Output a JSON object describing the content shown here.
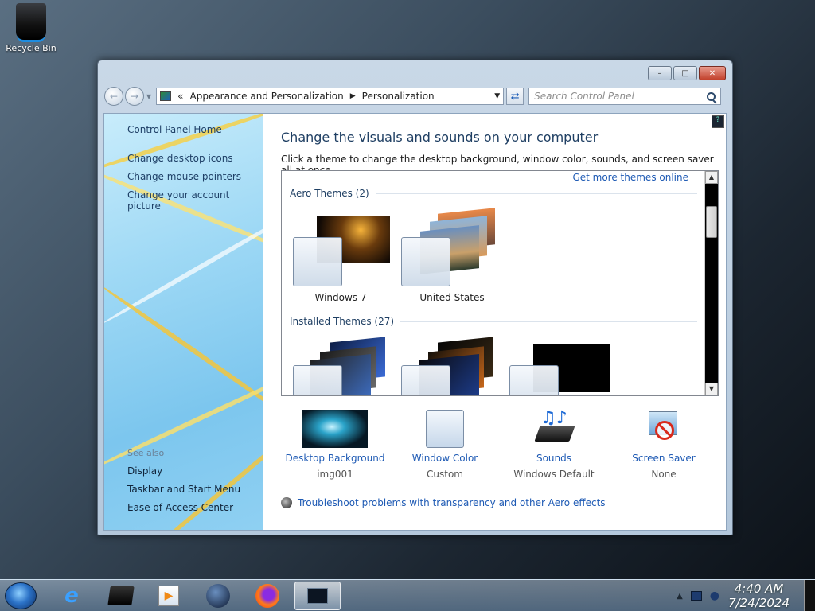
{
  "desktop": {
    "recycle_bin_label": "Recycle Bin"
  },
  "navbar": {
    "breadcrumb_root": "«",
    "crumb1": "Appearance and Personalization",
    "crumb2": "Personalization",
    "search_placeholder": "Search Control Panel"
  },
  "sidebar": {
    "home": "Control Panel Home",
    "links": [
      "Change desktop icons",
      "Change mouse pointers",
      "Change your account picture"
    ],
    "see_also_label": "See also",
    "see_also": [
      "Display",
      "Taskbar and Start Menu",
      "Ease of Access Center"
    ]
  },
  "main": {
    "title": "Change the visuals and sounds on your computer",
    "subtitle": "Click a theme to change the desktop background, window color, sounds, and screen saver all at once.",
    "get_more": "Get more themes online",
    "aero_header": "Aero Themes (2)",
    "installed_header": "Installed Themes (27)",
    "aero_themes": [
      {
        "name": "Windows 7"
      },
      {
        "name": "United States"
      }
    ]
  },
  "bottom": [
    {
      "label": "Desktop Background",
      "value": "img001"
    },
    {
      "label": "Window Color",
      "value": "Custom"
    },
    {
      "label": "Sounds",
      "value": "Windows Default"
    },
    {
      "label": "Screen Saver",
      "value": "None"
    }
  ],
  "troubleshoot": "Troubleshoot problems with transparency and other Aero effects",
  "taskbar": {
    "time": "4:40 AM",
    "date": "7/24/2024"
  },
  "colors": {
    "link": "#1e5ab4",
    "title": "#1f3f63",
    "close_button": "#c2412c"
  }
}
